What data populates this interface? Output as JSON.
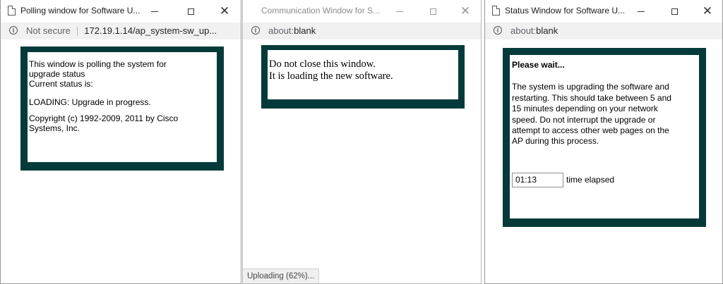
{
  "windows": [
    {
      "title": "Polling window for Software U...",
      "address_security": "Not secure",
      "address": "172.19.1.14/ap_system-sw_up...",
      "content": {
        "line1": "This window is polling the system for",
        "line2": "upgrade status",
        "line3": "Current status is:",
        "status": "LOADING: Upgrade in progress.",
        "copyright1": "Copyright (c) 1992-2009, 2011 by Cisco",
        "copyright2": "Systems, Inc."
      }
    },
    {
      "title": "Communication Window for S...",
      "address_scheme": "about:",
      "address_path": "blank",
      "content": {
        "line1": "Do not close this window.",
        "line2": "It is loading the new software."
      },
      "status_bar": "Uploading (62%)..."
    },
    {
      "title": "Status Window for Software U...",
      "address_scheme": "about:",
      "address_path": "blank",
      "content": {
        "heading": "Please wait...",
        "lines": [
          "The system is upgrading the software and",
          "restarting. This should take between 5 and",
          "15 minutes depending on your network",
          "speed. Do not interrupt the upgrade or",
          "attempt to access other web pages on the",
          "AP during this process."
        ],
        "timer_value": "01:13",
        "timer_label": "time elapsed"
      }
    }
  ],
  "icons": [
    "document-icon",
    "info-icon",
    "minimize-icon",
    "maximize-icon",
    "close-icon"
  ],
  "colors": {
    "panel_border": "#043a3a",
    "address_bar": "#f1f1f1"
  }
}
